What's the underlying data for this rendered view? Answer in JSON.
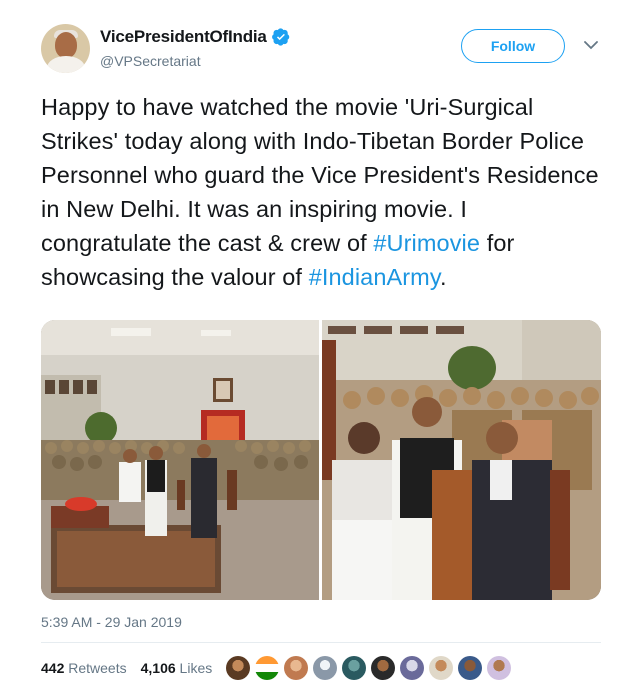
{
  "author": {
    "display_name": "VicePresidentOfIndia",
    "handle": "@VPSecretariat"
  },
  "follow_label": "Follow",
  "tweet": {
    "text_parts": {
      "part1": "Happy to have watched the movie 'Uri-Surgical Strikes' today along with Indo-Tibetan Border Police Personnel who guard the Vice President's Residence in New Delhi. It was an inspiring movie. I congratulate the cast & crew of ",
      "hashtag1": "#Urimovie",
      "part2": " for showcasing the valour of ",
      "hashtag2": "#IndianArmy",
      "part3": "."
    },
    "timestamp": "5:39 AM - 29 Jan 2019"
  },
  "stats": {
    "retweets_count": "442",
    "retweets_label": "Retweets",
    "likes_count": "4,106",
    "likes_label": "Likes"
  },
  "colors": {
    "accent": "#1da1f2",
    "hashtag": "#1b95e0",
    "secondary_text": "#657786"
  }
}
